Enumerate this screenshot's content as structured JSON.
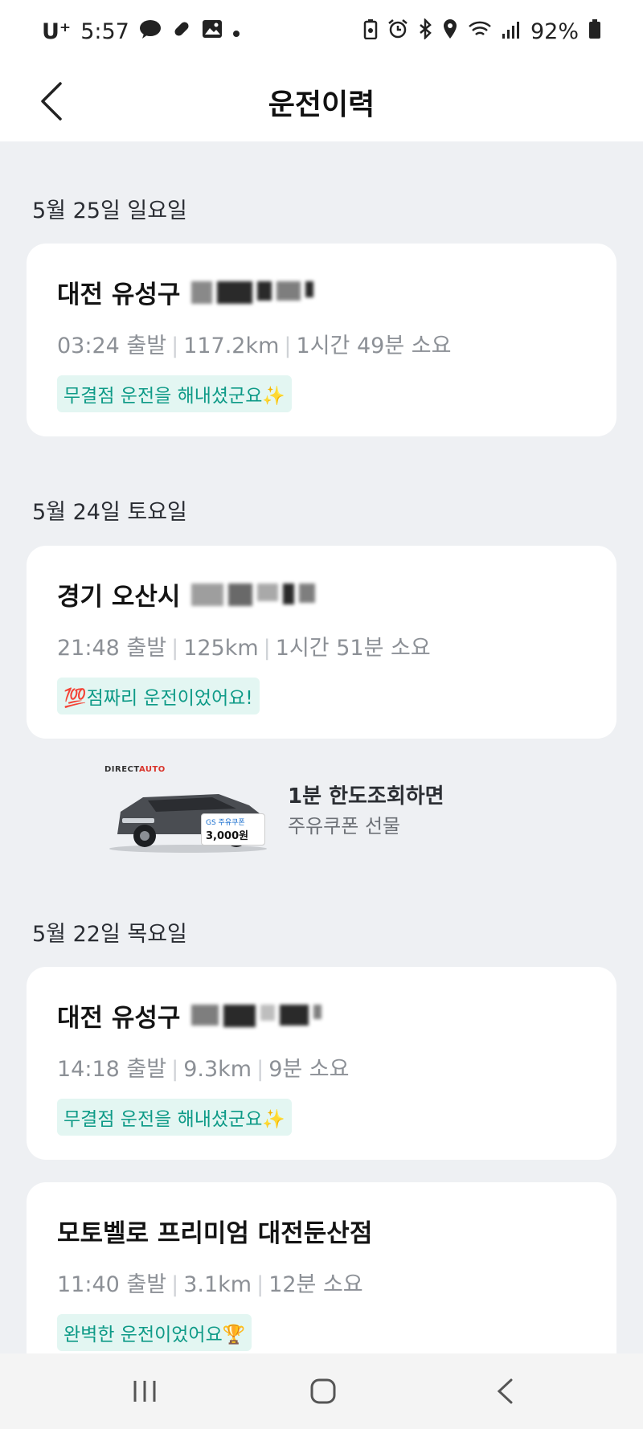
{
  "status_bar": {
    "carrier": "U⁺",
    "time": "5:57",
    "battery": "92%",
    "icons": [
      "talk-icon",
      "pill-icon",
      "gallery-icon",
      "dot-icon",
      "battery-saver-icon",
      "alarm-icon",
      "bluetooth-icon",
      "location-icon",
      "wifi-icon",
      "signal-icon",
      "battery-icon"
    ]
  },
  "header": {
    "title": "운전이력",
    "back_icon": "back-chevron-icon"
  },
  "sections": [
    {
      "date": "5월 25일 일요일",
      "trips": [
        {
          "title": "대전 유성구 ",
          "depart": "03:24 출발",
          "distance": "117.2km",
          "duration": "1시간 49분 소요",
          "badge": "무결점 운전을 해내셨군요✨"
        }
      ]
    },
    {
      "date": "5월 24일 토요일",
      "trips": [
        {
          "title": "경기 오산시 ",
          "depart": "21:48 출발",
          "distance": "125km",
          "duration": "1시간 51분 소요",
          "badge": "💯점짜리 운전이었어요!"
        }
      ]
    },
    {
      "date": "5월 22일 목요일",
      "trips": [
        {
          "title": "대전 유성구",
          "depart": "14:18 출발",
          "distance": "9.3km",
          "duration": "9분 소요",
          "badge": "무결점 운전을 해내셨군요✨"
        },
        {
          "title": "모토벨로 프리미엄 대전둔산점",
          "depart": "11:40 출발",
          "distance": "3.1km",
          "duration": "12분 소요",
          "badge": "완벽한 운전이었어요🏆"
        }
      ]
    }
  ],
  "ad": {
    "logo_prefix": "DIRECT",
    "logo_accent": "AUTO",
    "coupon_label": "GS 주유쿠폰",
    "coupon_amount": "3,000원",
    "title": "1분 한도조회하면",
    "subtitle": "주유쿠폰 선물"
  },
  "colors": {
    "background": "#eef0f3",
    "badge_bg": "#e3f6f2",
    "badge_text": "#0e9a87",
    "meta_text": "#8c9096"
  }
}
